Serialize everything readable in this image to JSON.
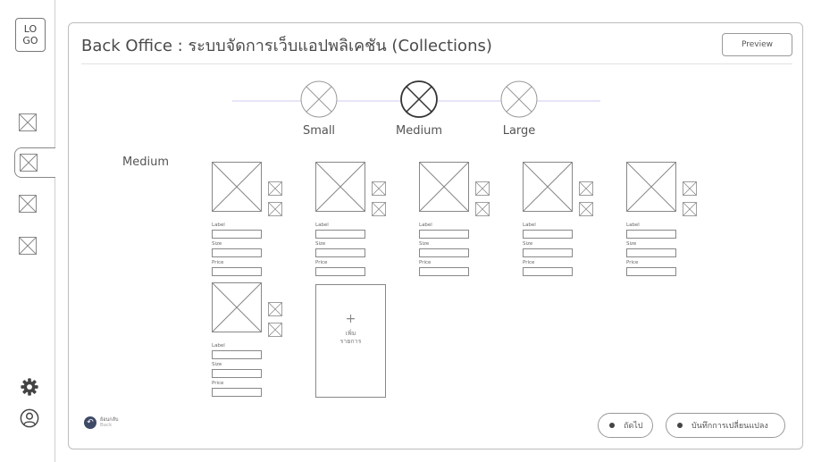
{
  "sidebar": {
    "logo": "LO\nGO",
    "items": [
      {
        "name": "sidebar-item-1",
        "active": false
      },
      {
        "name": "sidebar-item-2",
        "active": true
      },
      {
        "name": "sidebar-item-3",
        "active": false
      },
      {
        "name": "sidebar-item-4",
        "active": false
      }
    ],
    "settings_icon": "gear-icon",
    "profile_icon": "user-circle-icon"
  },
  "header": {
    "title": "Back Office : ระบบจัดการเว็บแอปพลิเคชัน (Collections)",
    "preview_label": "Preview"
  },
  "stepper": {
    "steps": [
      {
        "label": "Small",
        "active": false
      },
      {
        "label": "Medium",
        "active": true
      },
      {
        "label": "Large",
        "active": false
      }
    ]
  },
  "section": {
    "label": "Medium"
  },
  "cards": {
    "field_labels": {
      "label": "Label",
      "size": "Size",
      "price": "Price"
    },
    "items": [
      {
        "label": "",
        "size": "",
        "price": ""
      },
      {
        "label": "",
        "size": "",
        "price": ""
      },
      {
        "label": "",
        "size": "",
        "price": ""
      },
      {
        "label": "",
        "size": "",
        "price": ""
      },
      {
        "label": "",
        "size": "",
        "price": ""
      },
      {
        "label": "",
        "size": "",
        "price": ""
      }
    ]
  },
  "add_item": {
    "plus": "+",
    "label": "เพิ่ม\nรายการ"
  },
  "footer": {
    "back_th": "ย้อนกลับ",
    "back_en": "Back",
    "next_label": "ถัดไป",
    "save_label": "บันทึกการเปลี่ยนแปลง"
  },
  "colors": {
    "track": "#e5e5f7",
    "back_icon": "#3f4a66",
    "wire": "#888888"
  }
}
